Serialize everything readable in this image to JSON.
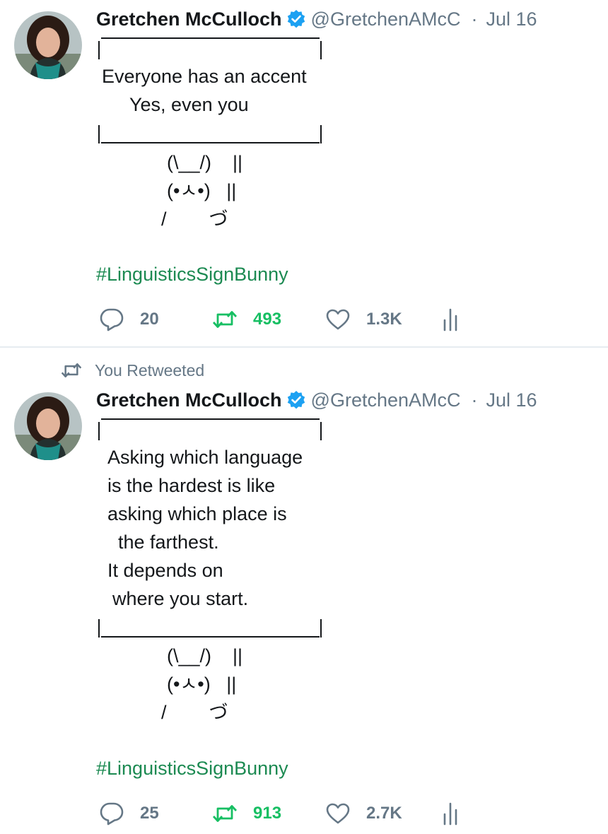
{
  "tweets": [
    {
      "display_name": "Gretchen McCulloch",
      "handle": "@GretchenAMcC",
      "separator": "·",
      "date": "Jul 16",
      "sign_text": [
        "Everyone has an accent",
        "Yes, even you"
      ],
      "bunny": [
        "(\\__/)    ||",
        "(•ㅅ•)   ||",
        "/        づ"
      ],
      "hashtag": "#LinguisticsSignBunny",
      "replies": "20",
      "retweets": "493",
      "likes": "1.3K"
    },
    {
      "retweet_context": "You Retweeted",
      "display_name": "Gretchen McCulloch",
      "handle": "@GretchenAMcC",
      "separator": "·",
      "date": "Jul 16",
      "sign_text": [
        "Asking which language",
        "is the hardest is like",
        "asking which place is",
        "the farthest.",
        "It depends on",
        "where you start."
      ],
      "bunny": [
        "(\\__/)    ||",
        "(•ㅅ•)   ||",
        "/        づ"
      ],
      "hashtag": "#LinguisticsSignBunny",
      "replies": "25",
      "retweets": "913",
      "likes": "2.7K"
    }
  ],
  "colors": {
    "text": "#14171a",
    "secondary": "#657786",
    "verified": "#1da1f2",
    "hashtag": "#1c8a52",
    "retweet_active": "#17bf63",
    "divider": "#e6ecf0"
  },
  "icons": {
    "reply": "reply-icon",
    "retweet": "retweet-icon",
    "like": "heart-icon",
    "analytics": "analytics-icon",
    "verified": "verified-badge-icon"
  }
}
